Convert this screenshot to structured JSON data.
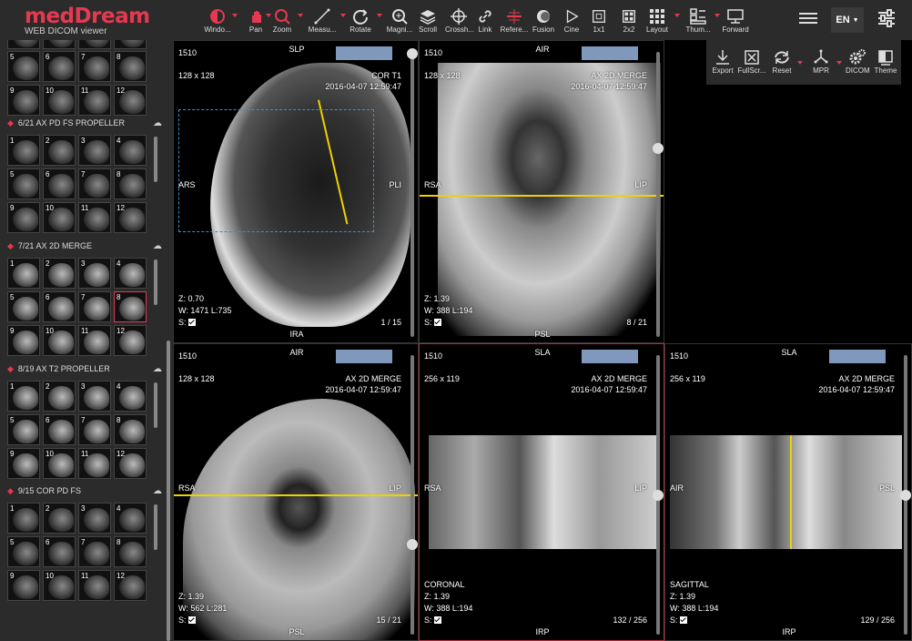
{
  "app": {
    "brand": "medDream",
    "subtitle": "WEB DICOM viewer",
    "lang": "EN"
  },
  "toolbar": [
    {
      "label": "Windo...",
      "icon": "window-level-icon"
    },
    {
      "label": "Pan",
      "icon": "hand-icon"
    },
    {
      "label": "Zoom",
      "icon": "zoom-icon"
    },
    {
      "label": "Measu...",
      "icon": "ruler-icon"
    },
    {
      "label": "Rotate",
      "icon": "rotate-icon"
    },
    {
      "label": "Magni...",
      "icon": "magnifier-icon"
    },
    {
      "label": "Scroll",
      "icon": "stack-icon"
    },
    {
      "label": "Crossh...",
      "icon": "crosshair-icon"
    },
    {
      "label": "Link",
      "icon": "link-icon"
    },
    {
      "label": "Refere...",
      "icon": "reference-lines-icon"
    },
    {
      "label": "Fusion",
      "icon": "fusion-icon"
    },
    {
      "label": "Cine",
      "icon": "play-icon"
    },
    {
      "label": "1x1",
      "icon": "layout-1x1-icon"
    },
    {
      "label": "2x2",
      "icon": "layout-2x2-icon"
    },
    {
      "label": "Layout",
      "icon": "grid-icon"
    },
    {
      "label": "Thum...",
      "icon": "thumbnails-icon"
    },
    {
      "label": "Forward",
      "icon": "forward-icon"
    }
  ],
  "popover": [
    {
      "label": "Export",
      "icon": "download-icon"
    },
    {
      "label": "FullScr...",
      "icon": "fullscreen-icon"
    },
    {
      "label": "Reset",
      "icon": "reset-icon"
    },
    {
      "label": "MPR",
      "icon": "mpr-axes-icon"
    },
    {
      "label": "DICOM",
      "icon": "gears-icon"
    },
    {
      "label": "Theme",
      "icon": "theme-icon"
    }
  ],
  "series": [
    {
      "title": "6/21  AX PD FS PROPELLER",
      "thumbs": [
        "1",
        "2",
        "3",
        "4",
        "5",
        "6",
        "7",
        "8",
        "9",
        "10",
        "11",
        "12"
      ]
    },
    {
      "title": "7/21  AX 2D MERGE",
      "thumbs": [
        "1",
        "2",
        "3",
        "4",
        "5",
        "6",
        "7",
        "8",
        "9",
        "10",
        "11",
        "12"
      ],
      "selected": "8"
    },
    {
      "title": "8/19  AX T2 PROPELLER",
      "thumbs": [
        "1",
        "2",
        "3",
        "4",
        "5",
        "6",
        "7",
        "8",
        "9",
        "10",
        "11",
        "12"
      ]
    },
    {
      "title": "9/15  COR PD FS",
      "thumbs": [
        "1",
        "2",
        "3",
        "4",
        "5",
        "6",
        "7",
        "8",
        "9",
        "10",
        "11",
        "12"
      ]
    }
  ],
  "top_thumbs": [
    "5",
    "6",
    "7",
    "8",
    "9",
    "10",
    "11",
    "12"
  ],
  "viewports": [
    {
      "id": "1510",
      "size": "128 x 128",
      "series": "COR T1",
      "date": "2016-04-07 12:59:47",
      "top": "SLP",
      "bottom": "IRA",
      "left": "ARS",
      "right": "PLI",
      "zoom": "Z: 0.70",
      "wl": "W: 1471 L:735",
      "s": "S:",
      "frame": "1 / 15"
    },
    {
      "id": "1510",
      "size": "128 x 128",
      "series": "AX 2D MERGE",
      "date": "2016-04-07 12:59:47",
      "top": "AIR",
      "bottom": "PSL",
      "left": "RSA",
      "right": "LIP",
      "zoom": "Z: 1.39",
      "wl": "W: 388 L:194",
      "s": "S:",
      "frame": "8 / 21"
    },
    {
      "id": "1510",
      "size": "128 x 128",
      "series": "AX 2D MERGE",
      "date": "2016-04-07 12:59:47",
      "top": "AIR",
      "bottom": "PSL",
      "left": "RSA",
      "right": "LIP",
      "zoom": "Z: 1.39",
      "wl": "W: 562 L:281",
      "s": "S:",
      "frame": "15 / 21"
    },
    {
      "id": "1510",
      "size": "256 x 119",
      "series": "AX 2D MERGE",
      "date": "2016-04-07 12:59:47",
      "top": "SLA",
      "bottom": "IRP",
      "left": "RSA",
      "right": "LIP",
      "plane": "CORONAL",
      "zoom": "Z: 1.39",
      "wl": "W: 388 L:194",
      "s": "S:",
      "frame": "132 / 256"
    },
    {
      "id": "1510",
      "size": "256 x 119",
      "series": "AX 2D MERGE",
      "date": "2016-04-07 12:59:47",
      "top": "SLA",
      "bottom": "IRP",
      "left": "AIR",
      "right": "PSL",
      "plane": "SAGITTAL",
      "zoom": "Z: 1.39",
      "wl": "W: 388 L:194",
      "s": "S:",
      "frame": "129 / 256"
    }
  ]
}
